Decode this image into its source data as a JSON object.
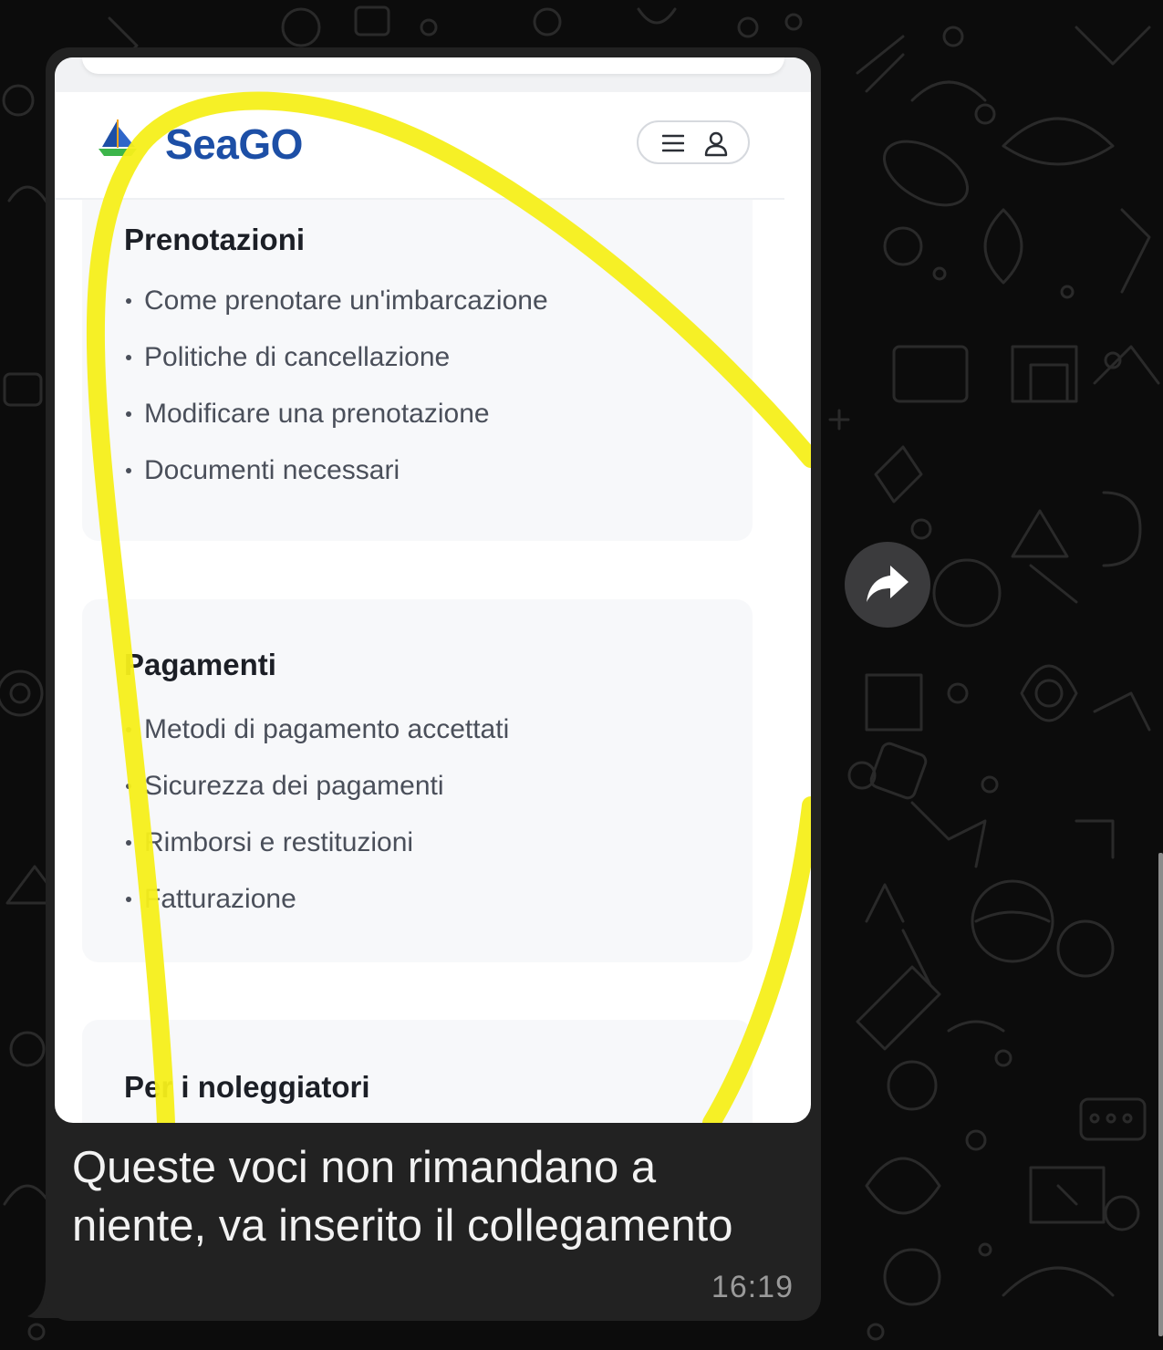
{
  "website": {
    "brand": "SeaGO",
    "header_icons": [
      "hamburger-menu-icon",
      "user-icon"
    ],
    "sections": [
      {
        "title": "Prenotazioni",
        "items": [
          "Come prenotare un'imbarcazione",
          "Politiche di cancellazione",
          "Modificare una prenotazione",
          "Documenti necessari"
        ]
      },
      {
        "title": "Pagamenti",
        "items": [
          "Metodi di pagamento accettati",
          "Sicurezza dei pagamenti",
          "Rimborsi e restituzioni",
          "Fatturazione"
        ]
      },
      {
        "title": "Per i noleggiatori",
        "items": []
      }
    ]
  },
  "message": {
    "caption": "Queste voci non rimandano a niente, va inserito il collegamento",
    "time": "16:19"
  },
  "colors": {
    "brand_blue": "#1d4fa6",
    "highlight_yellow": "#f5ef1a",
    "bubble": "#222222",
    "chat_background": "#0c0c0c"
  }
}
